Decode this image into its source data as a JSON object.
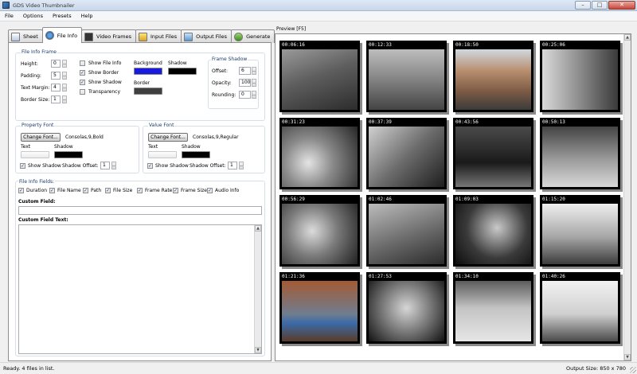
{
  "window": {
    "title": "GDS Video Thumbnailer"
  },
  "menu": [
    "File",
    "Options",
    "Presets",
    "Help"
  ],
  "tabs": [
    {
      "label": "Sheet",
      "icon": "sheet-icon"
    },
    {
      "label": "File Info",
      "icon": "info-icon",
      "active": true
    },
    {
      "label": "Video Frames",
      "icon": "film-icon"
    },
    {
      "label": "Input Files",
      "icon": "folder-icon"
    },
    {
      "label": "Output Files",
      "icon": "output-icon"
    },
    {
      "label": "Generate",
      "icon": "generate-icon"
    }
  ],
  "file_info_frame": {
    "title": "File Info Frame",
    "height_label": "Height:",
    "height_value": "0",
    "padding_label": "Padding:",
    "padding_value": "5",
    "text_margin_label": "Text Margin:",
    "text_margin_value": "4",
    "border_size_label": "Border Size:",
    "border_size_value": "1",
    "show_file_info": "Show File Info",
    "show_border": "Show Border",
    "show_shadow": "Show Shadow",
    "transparency": "Transparency",
    "background_label": "Background",
    "shadow_label": "Shadow",
    "border_label": "Border",
    "background_color": "#1a1adf",
    "shadow_color": "#000000",
    "border_color": "#3f3f3f"
  },
  "frame_shadow": {
    "title": "Frame Shadow",
    "offset_label": "Offset:",
    "offset_value": "6",
    "opacity_label": "Opacity:",
    "opacity_value": "100",
    "rounding_label": "Rounding:",
    "rounding_value": "0"
  },
  "property_font": {
    "title": "Property Font",
    "button": "Change Font...",
    "font_name": "Consolas,9,Bold",
    "text_label": "Text",
    "shadow_label": "Shadow",
    "show_shadow": "Show Shadow",
    "shadow_offset_label": "Shadow Offset:",
    "shadow_offset_value": "1"
  },
  "value_font": {
    "title": "Value Font",
    "button": "Change Font...",
    "font_name": "Consolas,9,Regular",
    "text_label": "Text",
    "shadow_label": "Shadow",
    "show_shadow": "Show Shadow",
    "shadow_offset_label": "Shadow Offset:",
    "shadow_offset_value": "1"
  },
  "file_info_fields": {
    "title": "File Info Fields:",
    "fields": [
      "Duration",
      "File Name",
      "Path",
      "File Size",
      "Frame Rate",
      "Frame Size",
      "Audio Info"
    ],
    "custom_field_label": "Custom Field:",
    "custom_field_text_label": "Custom Field Text:"
  },
  "preview": {
    "label": "Preview  [F5]",
    "timestamps": [
      "00:06:16",
      "00:12:33",
      "00:18:50",
      "00:25:06",
      "00:31:23",
      "00:37:39",
      "00:43:56",
      "00:50:13",
      "00:56:29",
      "01:02:46",
      "01:09:03",
      "01:15:20",
      "01:21:36",
      "01:27:53",
      "01:34:10",
      "01:40:26"
    ]
  },
  "status": {
    "left": "Ready. 4 files in list.",
    "right": "Output Size: 850 x 780"
  }
}
